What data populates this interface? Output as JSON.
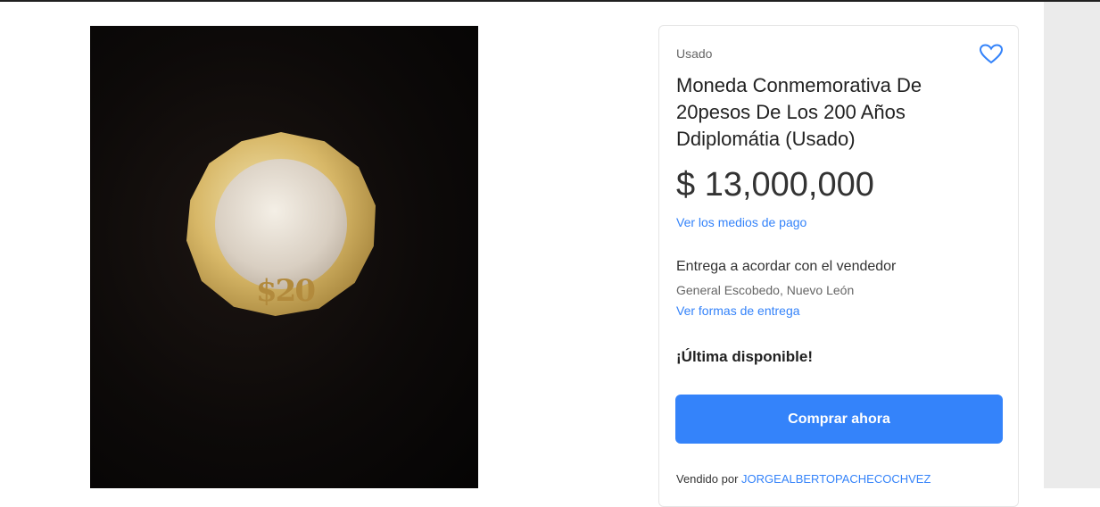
{
  "product": {
    "condition": "Usado",
    "title": "Moneda Conmemorativa De 20pesos De Los 200 Años Ddiplomátia (Usado)",
    "price": "$ 13,000,000",
    "payment_link": "Ver los medios de pago",
    "delivery": "Entrega a acordar con el vendedor",
    "location": "General Escobedo, Nuevo León",
    "shipping_link": "Ver formas de entrega",
    "stock": "¡Última disponible!",
    "buy_label": "Comprar ahora",
    "seller_prefix": "Vendido por",
    "seller_name": "JORGEALBERTOPACHECOCHVEZ"
  },
  "image": {
    "coin_value_text": "$20"
  },
  "icons": {
    "favorite": "heart-outline-icon"
  },
  "colors": {
    "accent": "#3483fa",
    "photo_background": "#0d0a09"
  }
}
